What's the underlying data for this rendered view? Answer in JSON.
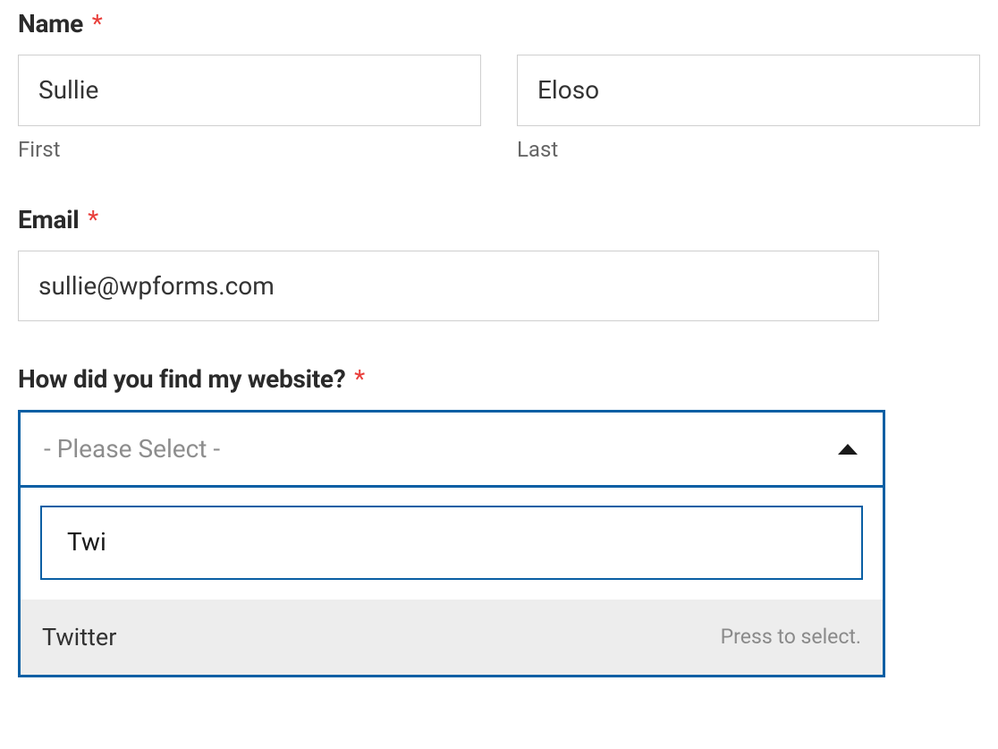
{
  "name": {
    "label": "Name",
    "required_mark": "*",
    "first_value": "Sullie",
    "first_sub": "First",
    "last_value": "Eloso",
    "last_sub": "Last"
  },
  "email": {
    "label": "Email",
    "required_mark": "*",
    "value": "sullie@wpforms.com"
  },
  "source": {
    "label": "How did you find my website?",
    "required_mark": "*",
    "placeholder": "- Please Select -",
    "search_value": "Twi",
    "option_label": "Twitter",
    "option_hint": "Press to select."
  }
}
